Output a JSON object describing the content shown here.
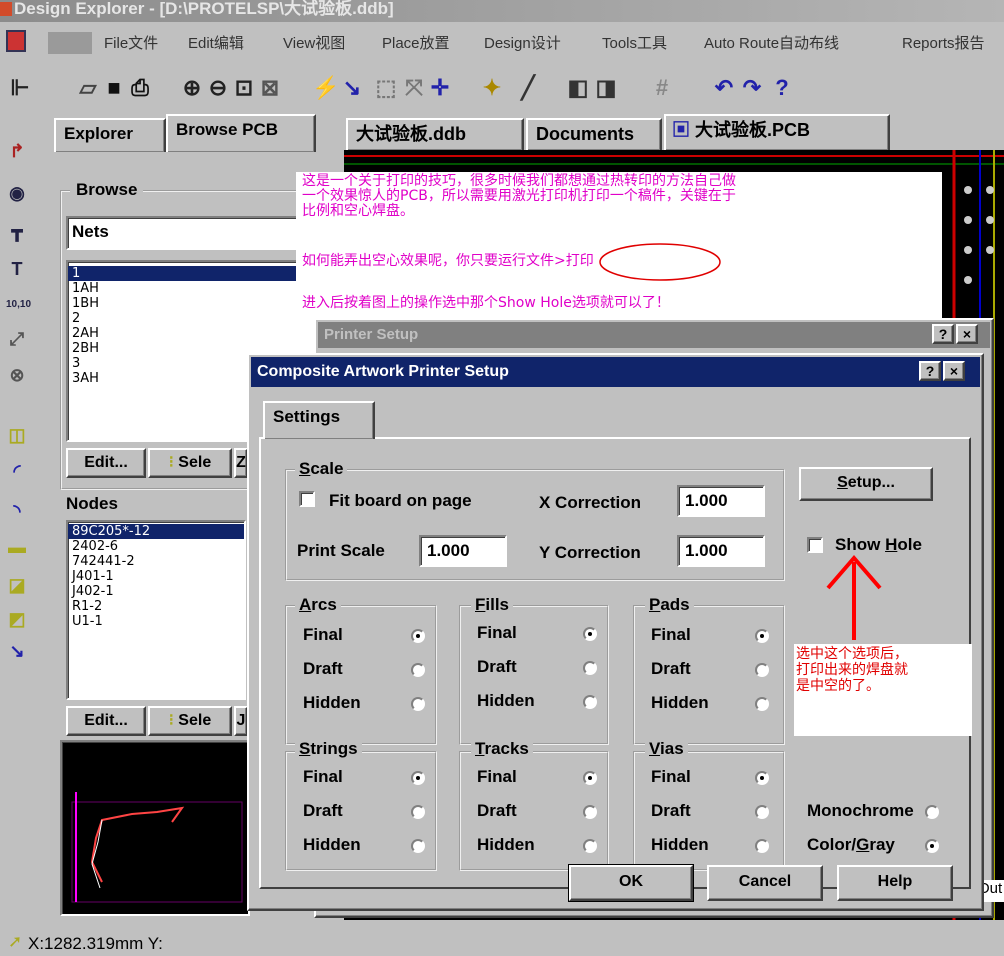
{
  "window": {
    "title": "Design Explorer - [D:\\PROTELSP\\大试验板.ddb]"
  },
  "menu": [
    "File文件",
    "Edit编辑",
    "View视图",
    "Place放置",
    "Design设计",
    "Tools工具",
    "Auto Route自动布线",
    "Reports报告"
  ],
  "toolbar": {
    "icons": [
      "board-icon",
      "open-icon",
      "save-icon",
      "print-icon",
      "zoom-in-icon",
      "zoom-out-icon",
      "zoom-area-icon",
      "zoom-fit-icon",
      "cross-probe-icon",
      "route-icon",
      "select-icon",
      "deselect-icon",
      "move-icon",
      "wand-icon",
      "pen-icon",
      "library-icon",
      "browse-icon",
      "grid-icon",
      "undo-icon",
      "redo-icon",
      "help-icon"
    ]
  },
  "explorer": {
    "tabs": [
      "Explorer",
      "Browse PCB"
    ],
    "browse_label": "Browse",
    "browse_select": "Nets",
    "nets": [
      "1",
      "1AH",
      "1BH",
      "2",
      "2AH",
      "2BH",
      "3",
      "3AH"
    ],
    "nets_buttons": [
      "Edit...",
      "Sele",
      "Z"
    ],
    "nodes_label": "Nodes",
    "nodes": [
      "89C205*-12",
      "2402-6",
      "742441-2",
      "J401-1",
      "J402-1",
      "R1-2",
      "U1-1"
    ],
    "nodes_buttons": [
      "Edit...",
      "Sele",
      "J"
    ]
  },
  "doc_tabs": [
    "大试验板.ddb",
    "Documents",
    "大试验板.PCB"
  ],
  "annotation": {
    "line1": "这是一个关于打印的技巧，很多时候我们都想通过热转印的方法自己做",
    "line2": "一个效果惊人的PCB，所以需要用激光打印机打印一个稿件，关键在于",
    "line3": "比例和空心焊盘。",
    "line4": "如何能弄出空心效果呢，你只要运行文件>打印",
    "line5": "进入后按着图上的操作选中那个Show Hole选项就可以了！"
  },
  "bg_dialog": {
    "title": "Printer Setup"
  },
  "dialog": {
    "title": "Composite Artwork Printer Setup",
    "help_btn": "?",
    "close_btn": "×",
    "tab": "Settings",
    "scale": {
      "label": "Scale",
      "fit_board": "Fit board on page",
      "x_correction_label": "X Correction",
      "x_correction": "1.000",
      "print_scale_label": "Print Scale",
      "print_scale": "1.000",
      "y_correction_label": "Y Correction",
      "y_correction": "1.000"
    },
    "setup_button": "Setup...",
    "show_hole": "Show Hole",
    "options": {
      "final": "Final",
      "draft": "Draft",
      "hidden": "Hidden"
    },
    "groups": [
      {
        "title": "Arcs",
        "selected": "Final"
      },
      {
        "title": "Fills",
        "selected": "Final"
      },
      {
        "title": "Pads",
        "selected": "Final"
      },
      {
        "title": "Strings",
        "selected": "Final"
      },
      {
        "title": "Tracks",
        "selected": "Final"
      },
      {
        "title": "Vias",
        "selected": "Final"
      }
    ],
    "monochrome": "Monochrome",
    "color_gray": "Color/Gray",
    "color_mode_selected": "Color/Gray",
    "ok": "OK",
    "cancel": "Cancel",
    "help": "Help"
  },
  "note": {
    "line1": "选中这个选项后，",
    "line2": "打印出来的焊盘就",
    "line3": "是中空的了。"
  },
  "status": {
    "coords": "X:1282.319mm Y:"
  },
  "right_edge_label": "Out",
  "colors": {
    "title_active": "#10246a",
    "annotation": "#e000c8",
    "note": "#e00000",
    "arrow": "#ff0000"
  }
}
